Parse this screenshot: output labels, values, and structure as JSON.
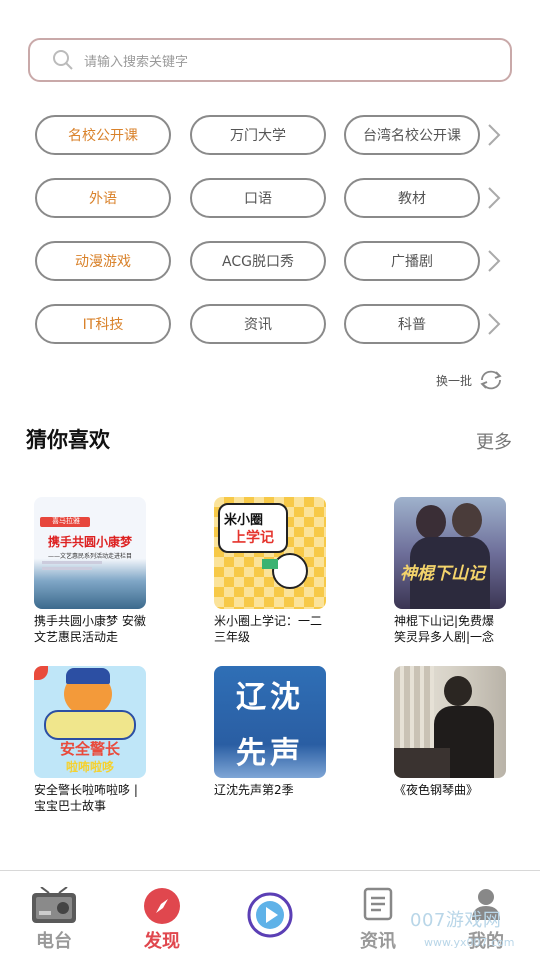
{
  "search": {
    "placeholder": "请输入搜索关键字",
    "icon": "search-icon"
  },
  "categories": [
    {
      "row": 1,
      "items": [
        "名校公开课",
        "万门大学",
        "台湾名校公开课"
      ]
    },
    {
      "row": 2,
      "items": [
        "外语",
        "口语",
        "教材"
      ]
    },
    {
      "row": 3,
      "items": [
        "动漫游戏",
        "ACG脱口秀",
        "广播剧"
      ]
    },
    {
      "row": 4,
      "items": [
        "IT科技",
        "资讯",
        "科普"
      ]
    }
  ],
  "refresh_label": "换一批",
  "recommend": {
    "title": "猜你喜欢",
    "more": "更多",
    "cards": [
      {
        "caption": "携手共圆小康梦 安徽文艺惠民活动走",
        "thumb_title": "携手共圆小康梦",
        "thumb_sub": "——文艺惠民系列活动走进栏目",
        "thumb_brand": "喜马拉雅"
      },
      {
        "caption": "米小圈上学记：一二三年级",
        "thumb_title": "米小圈",
        "thumb_sub": "上学记"
      },
      {
        "caption": "神棍下山记|免费爆笑灵异多人剧|一念",
        "thumb_title": "神棍下山记"
      },
      {
        "caption": "安全警长啦咘啦哆 | 宝宝巴士故事",
        "thumb_title": "安全警长",
        "thumb_sub": "啦咘啦哆"
      },
      {
        "caption": "辽沈先声第2季",
        "thumb_title": "辽沈",
        "thumb_sub": "先声"
      },
      {
        "caption": "《夜色钢琴曲》"
      }
    ]
  },
  "tabs": [
    {
      "label": "电台",
      "icon": "radio-icon",
      "active": false
    },
    {
      "label": "发现",
      "icon": "compass-icon",
      "active": true
    },
    {
      "label": "",
      "icon": "play-icon",
      "active": false
    },
    {
      "label": "资讯",
      "icon": "news-icon",
      "active": false
    },
    {
      "label": "我的",
      "icon": "user-icon",
      "active": false
    }
  ],
  "colors": {
    "accent": "#d9822b",
    "active_tab": "#e0474e",
    "border": "#8a8a8a"
  },
  "watermark": {
    "text": "007游戏网",
    "url": "www.yx007.com"
  }
}
